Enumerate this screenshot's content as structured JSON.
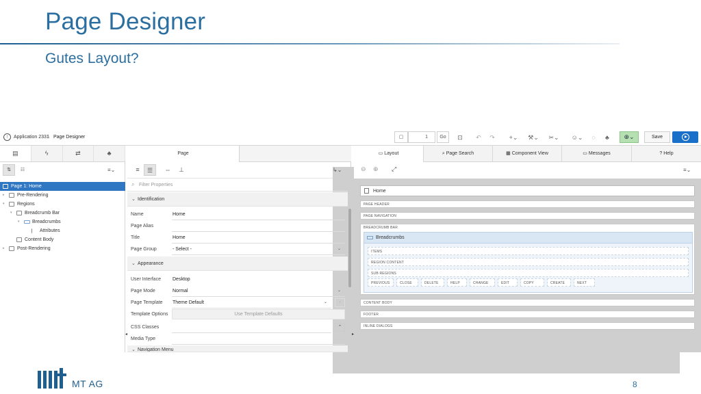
{
  "slide": {
    "title": "Page Designer",
    "subtitle": "Gutes Layout?",
    "page_number": "8",
    "logo_text": "MT AG"
  },
  "topbar": {
    "app_name": "Application 2331",
    "separator": "\\",
    "page_name": "Page Designer",
    "page_number_value": "1",
    "go_label": "Go",
    "save_label": "Save"
  },
  "left_pane": {
    "tree": [
      {
        "label": "Page 1: Home",
        "level": 0,
        "icon": "page-icon",
        "selected": true
      },
      {
        "label": "Pre-Rendering",
        "level": 0,
        "icon": "folder-icon",
        "expander": "▸"
      },
      {
        "label": "Regions",
        "level": 0,
        "icon": "folder-icon",
        "expander": "▾"
      },
      {
        "label": "Breadcrumb Bar",
        "level": 1,
        "icon": "folder-icon",
        "expander": "▾"
      },
      {
        "label": "Breadcrumbs",
        "level": 2,
        "icon": "breadcrumb-icon",
        "expander": "▾"
      },
      {
        "label": "Attributes",
        "level": 3,
        "icon": "list-icon"
      },
      {
        "label": "Content Body",
        "level": 1,
        "icon": "folder-icon"
      },
      {
        "label": "Post-Rendering",
        "level": 0,
        "icon": "folder-icon",
        "expander": "▸"
      }
    ]
  },
  "middle_pane": {
    "tab_label": "Page",
    "filter_placeholder": "Filter Properties",
    "groups": {
      "identification": "Identification",
      "appearance": "Appearance",
      "navigation_menu": "Navigation Menu"
    },
    "props": {
      "name": {
        "label": "Name",
        "value": "Home"
      },
      "page_alias": {
        "label": "Page Alias",
        "value": ""
      },
      "title": {
        "label": "Title",
        "value": "Home"
      },
      "page_group": {
        "label": "Page Group",
        "value": "- Select -"
      },
      "user_interface": {
        "label": "User Interface",
        "value": "Desktop"
      },
      "page_mode": {
        "label": "Page Mode",
        "value": "Normal"
      },
      "page_template": {
        "label": "Page Template",
        "value": "Theme Default"
      },
      "template_options": {
        "label": "Template Options",
        "value": "Use Template Defaults"
      },
      "css_classes": {
        "label": "CSS Classes",
        "value": ""
      },
      "media_type": {
        "label": "Media Type",
        "value": ""
      }
    }
  },
  "right_pane": {
    "tabs": [
      "Layout",
      "Page Search",
      "Component View",
      "Messages",
      "Help"
    ],
    "home_label": "Home",
    "slots": {
      "page_header": "PAGE HEADER",
      "page_navigation": "PAGE NAVIGATION",
      "breadcrumb_bar": "BREADCRUMB BAR",
      "content_body": "CONTENT BODY",
      "footer": "FOOTER",
      "inline_dialogs": "INLINE DIALOGS"
    },
    "region_title": "Breadcrumbs",
    "sub_slots": [
      "ITEMS",
      "REGION CONTENT",
      "SUB REGIONS"
    ],
    "button_positions": [
      "PREVIOUS",
      "CLOSE",
      "DELETE",
      "HELP",
      "CHANGE",
      "EDIT",
      "COPY",
      "CREATE",
      "NEXT"
    ]
  },
  "colors": {
    "title_blue": "#2b6ea0",
    "selection_blue": "#2f76c3",
    "run_button": "#1a6fc9"
  }
}
